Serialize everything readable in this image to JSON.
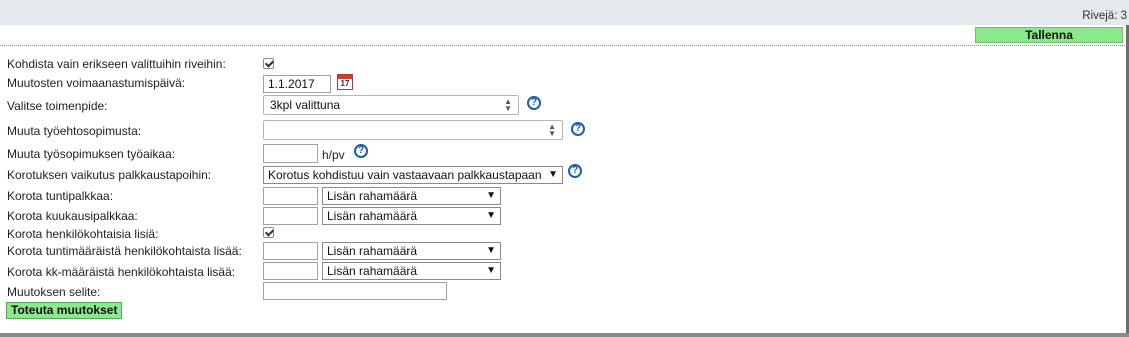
{
  "header": {
    "rows_label": "Rivejä: 3",
    "save_label": "Tallenna"
  },
  "form": {
    "only_selected_label": "Kohdista vain erikseen valittuihin riveihin:",
    "only_selected_checked": true,
    "effective_date_label": "Muutosten voimaanastumispäivä:",
    "effective_date_value": "1.1.2017",
    "calendar_icon_text": "17",
    "action_label": "Valitse toimenpide:",
    "action_value": "3kpl valittuna",
    "agreement_label": "Muuta työehtosopimusta:",
    "agreement_value": "",
    "working_time_label": "Muuta työsopimuksen työaikaa:",
    "working_time_value": "",
    "working_time_unit": "h/pv",
    "raise_effect_label": "Korotuksen vaikutus palkkaustapoihin:",
    "raise_effect_value": "Korotus kohdistuu vain vastaavaan palkkaustapaan",
    "hourly_label": "Korota tuntipalkkaa:",
    "hourly_value": "",
    "hourly_mode": "Lisän rahamäärä",
    "monthly_label": "Korota kuukausipalkkaa:",
    "monthly_value": "",
    "monthly_mode": "Lisän rahamäärä",
    "personal_label": "Korota henkilökohtaisia lisiä:",
    "personal_checked": true,
    "hourly_personal_label": "Korota tuntimääräistä henkilökohtaista lisää:",
    "hourly_personal_value": "",
    "hourly_personal_mode": "Lisän rahamäärä",
    "monthly_personal_label": "Korota kk-määräistä henkilökohtaista lisää:",
    "monthly_personal_value": "",
    "monthly_personal_mode": "Lisän rahamäärä",
    "description_label": "Muutoksen selite:",
    "description_value": "",
    "help_glyph": "?",
    "apply_label": "Toteuta muutokset"
  },
  "icons": [
    "calendar-icon",
    "help-icon",
    "checkbox-checked",
    "select-arrows-icon",
    "dropdown-triangle-icon"
  ],
  "colors": {
    "button_green": "#8ce88c",
    "help_blue": "#1b5fa8",
    "topbar": "#e4e9ee"
  }
}
